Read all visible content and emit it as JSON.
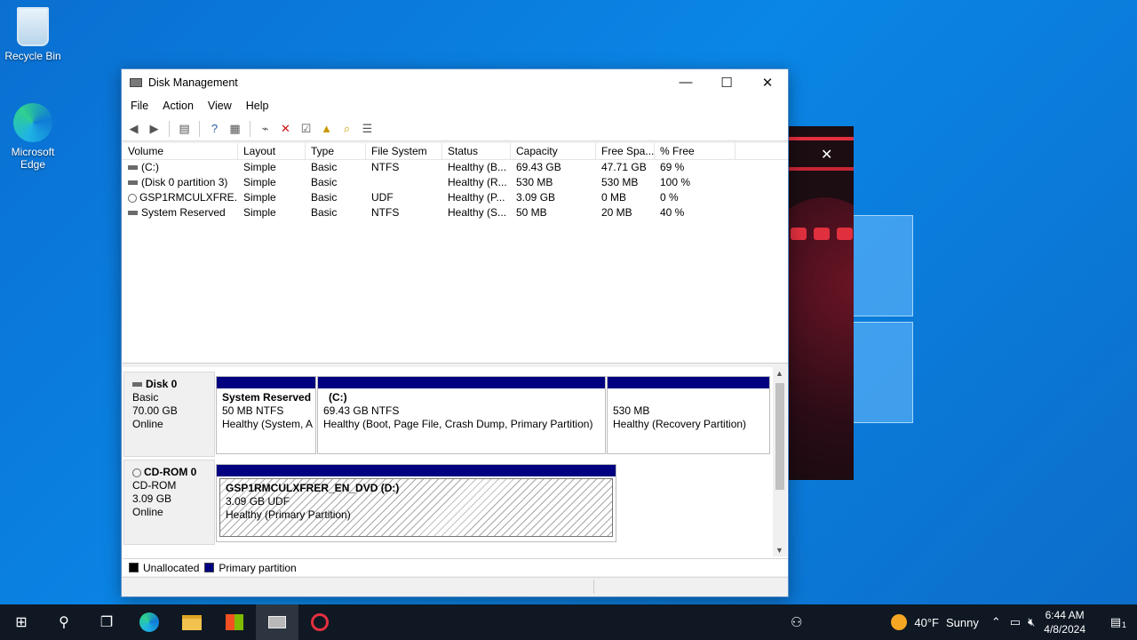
{
  "desktop": {
    "icons": [
      {
        "label": "Recycle Bin"
      },
      {
        "label": "Microsoft Edge"
      }
    ]
  },
  "window": {
    "title": "Disk Management",
    "controls": {
      "minimize": "—",
      "maximize": "☐",
      "close": "✕"
    }
  },
  "menu": [
    "File",
    "Action",
    "View",
    "Help"
  ],
  "volume_table": {
    "columns": [
      "Volume",
      "Layout",
      "Type",
      "File System",
      "Status",
      "Capacity",
      "Free Spa...",
      "% Free"
    ],
    "rows": [
      [
        "(C:)",
        "Simple",
        "Basic",
        "NTFS",
        "Healthy (B...",
        "69.43 GB",
        "47.71 GB",
        "69 %"
      ],
      [
        "(Disk 0 partition 3)",
        "Simple",
        "Basic",
        "",
        "Healthy (R...",
        "530 MB",
        "530 MB",
        "100 %"
      ],
      [
        "GSP1RMCULXFRE...",
        "Simple",
        "Basic",
        "UDF",
        "Healthy (P...",
        "3.09 GB",
        "0 MB",
        "0 %"
      ],
      [
        "System Reserved",
        "Simple",
        "Basic",
        "NTFS",
        "Healthy (S...",
        "50 MB",
        "20 MB",
        "40 %"
      ]
    ]
  },
  "disks": {
    "disk0": {
      "name": "Disk 0",
      "type": "Basic",
      "size": "70.00 GB",
      "state": "Online",
      "partitions": [
        {
          "name": "System Reserved",
          "size": "50 MB NTFS",
          "status": "Healthy (System, A"
        },
        {
          "name": "(C:)",
          "size": "69.43 GB NTFS",
          "status": "Healthy (Boot, Page File, Crash Dump, Primary Partition)"
        },
        {
          "name": "",
          "size": "530 MB",
          "status": "Healthy (Recovery Partition)"
        }
      ]
    },
    "cdrom0": {
      "name": "CD-ROM 0",
      "type": "CD-ROM",
      "size": "3.09 GB",
      "state": "Online",
      "partitions": [
        {
          "name": "GSP1RMCULXFRER_EN_DVD  (D:)",
          "size": "3.09 GB UDF",
          "status": "Healthy (Primary Partition)"
        }
      ]
    }
  },
  "legend": {
    "unallocated": "Unallocated",
    "primary": "Primary partition",
    "unallocated_color": "#000000",
    "primary_color": "#000080"
  },
  "taskbar": {
    "weather": {
      "temp": "40°F",
      "condition": "Sunny"
    },
    "clock": {
      "time": "6:44 AM",
      "date": "4/8/2024"
    },
    "notification_count": "1"
  }
}
